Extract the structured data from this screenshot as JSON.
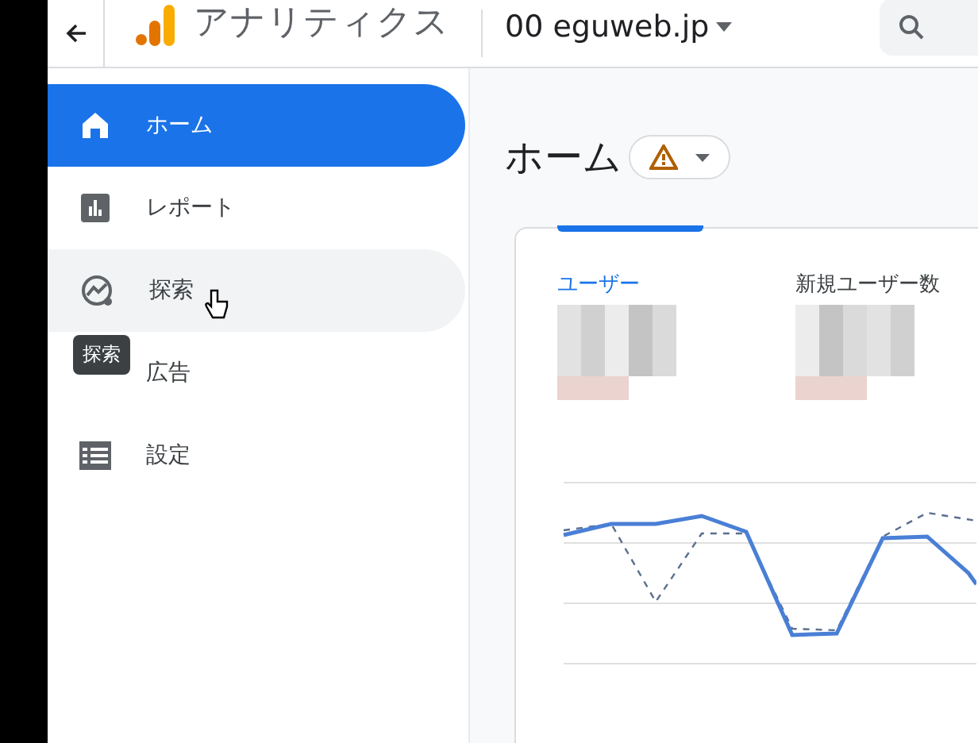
{
  "header": {
    "product": "アナリティクス",
    "property": "00 eguweb.jp"
  },
  "sidebar": {
    "items": [
      {
        "label": "ホーム",
        "kind": "home",
        "selected": true,
        "hovered": false
      },
      {
        "label": "レポート",
        "kind": "report",
        "selected": false,
        "hovered": false
      },
      {
        "label": "探索",
        "kind": "explore",
        "selected": false,
        "hovered": true
      },
      {
        "label": "広告",
        "selected": false,
        "hovered": false
      },
      {
        "label": "設定",
        "kind": "settings",
        "selected": false,
        "hovered": false
      }
    ],
    "tooltip": "探索"
  },
  "page": {
    "title": "ホーム"
  },
  "card": {
    "metrics": [
      {
        "label": "ユーザー",
        "selected": true
      },
      {
        "label": "新規ユーザー数",
        "selected": false
      }
    ]
  }
}
